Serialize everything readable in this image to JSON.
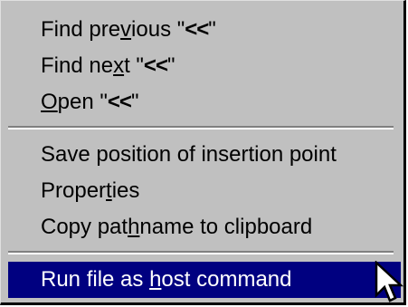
{
  "menu": {
    "items": [
      {
        "pre": "Find pre",
        "accel": "v",
        "post": "ious \"",
        "chev": "<<",
        "end": "\""
      },
      {
        "pre": "Find ne",
        "accel": "x",
        "post": "t \"",
        "chev": "<<",
        "end": "\""
      },
      {
        "pre": "",
        "accel": "O",
        "post": "pen \"",
        "chev": "<<",
        "end": "\""
      },
      {
        "pre": "Save position of insertion point",
        "accel": "",
        "post": "",
        "chev": "",
        "end": ""
      },
      {
        "pre": "Proper",
        "accel": "t",
        "post": "ies",
        "chev": "",
        "end": ""
      },
      {
        "pre": "Copy pat",
        "accel": "h",
        "post": "name to clipboard",
        "chev": "",
        "end": ""
      },
      {
        "pre": "Run file as ",
        "accel": "h",
        "post": "ost command",
        "chev": "",
        "end": ""
      }
    ],
    "selected_index": 6
  },
  "colors": {
    "menu_bg": "#c0c0c0",
    "highlight_bg": "#000080",
    "highlight_text": "#ffffff"
  },
  "icons": {
    "cursor": "arrow-pointer-icon"
  }
}
